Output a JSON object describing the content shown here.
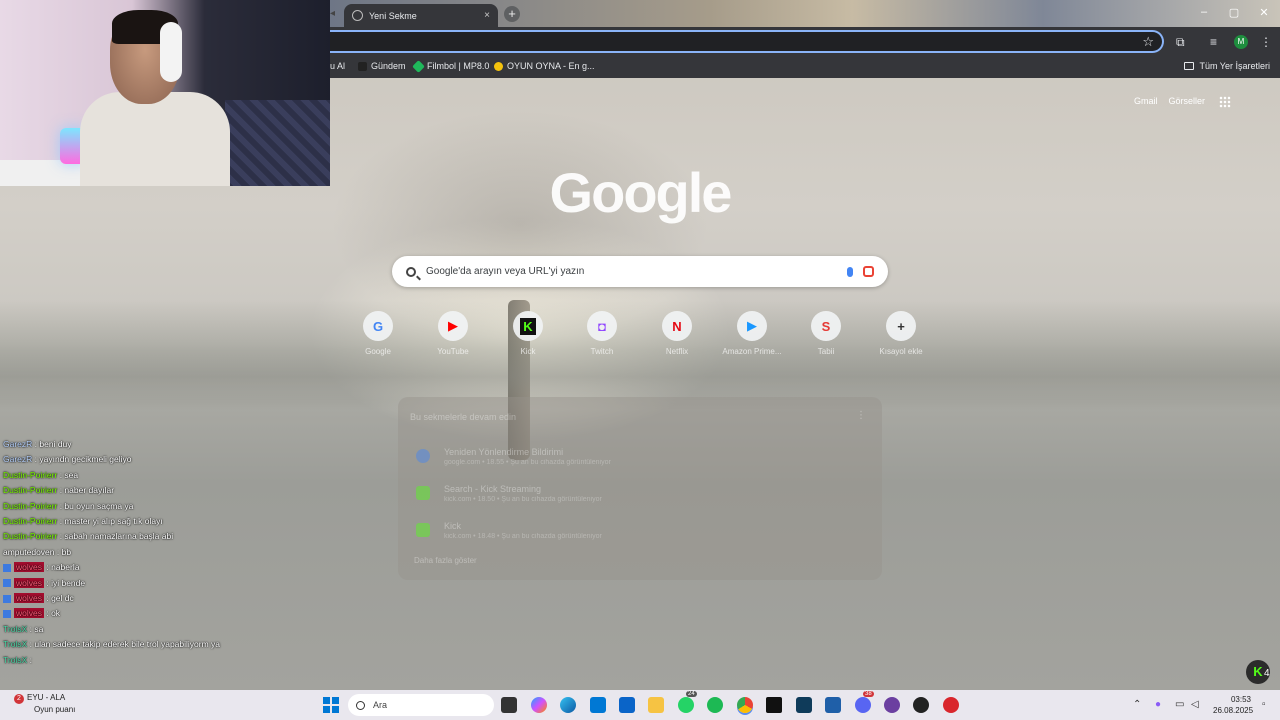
{
  "browser": {
    "tab_title": "Yeni Sekme",
    "tab_close": "×",
    "new_tab": "+",
    "back_glyph": "◂",
    "window_controls": [
      "–",
      "▢",
      "✕"
    ],
    "star": "☆",
    "profile_initial": "M",
    "bookmarks": [
      {
        "label": "u Al",
        "color": "#cfd4da"
      },
      {
        "label": "Gündem",
        "color": "#2a2a2a"
      },
      {
        "label": "Filmbol | MP8.0",
        "color": "#1fb85b"
      },
      {
        "label": "OYUN OYNA - En g...",
        "color": "#f4c20d"
      }
    ],
    "all_bookmarks": "Tüm Yer İşaretleri"
  },
  "ntp": {
    "links": [
      "Gmail",
      "Görseller"
    ],
    "logo": "Google",
    "search_placeholder": "Google'da arayın veya URL'yi yazın",
    "shortcuts": [
      {
        "label": "Google",
        "glyph": "G",
        "color": "#4285f4"
      },
      {
        "label": "YouTube",
        "glyph": "▶",
        "color": "#ff0000"
      },
      {
        "label": "Kick",
        "glyph": "K",
        "color": "#53fc18"
      },
      {
        "label": "Twitch",
        "glyph": "◘",
        "color": "#9146ff"
      },
      {
        "label": "Netflix",
        "glyph": "N",
        "color": "#e50914"
      },
      {
        "label": "Amazon Prime...",
        "glyph": "▶",
        "color": "#1a98ff"
      },
      {
        "label": "Tabii",
        "glyph": "S",
        "color": "#e53935"
      },
      {
        "label": "Kısayol ekle",
        "glyph": "+",
        "color": "#333333"
      }
    ],
    "resume": {
      "title": "Bu sekmelerle devam edin",
      "items": [
        {
          "title": "Yeniden Yönlendirme Bildirimi",
          "subtitle": "google.com • 18.55 • Şu an bu cihazda görüntüleniyor",
          "color": "#4285f4"
        },
        {
          "title": "Search - Kick Streaming",
          "subtitle": "kick.com • 18.50 • Şu an bu cihazda görüntüleniyor",
          "color": "#53fc18"
        },
        {
          "title": "Kick",
          "subtitle": "kick.com • 18.48 • Şu an bu cihazda görüntüleniyor",
          "color": "#53fc18"
        }
      ],
      "more": "Daha fazla göster"
    }
  },
  "chat": [
    {
      "user": "GarezR",
      "msg": "beni duy",
      "color": "#b9d4ff",
      "badge": false
    },
    {
      "user": "GarezR",
      "msg": "yayındn gecikmeli geliyo",
      "color": "#b9d4ff",
      "badge": false
    },
    {
      "user": "Dustin-Poirierr",
      "msg": "sea",
      "color": "#7cfc00",
      "badge": false
    },
    {
      "user": "Dustin-Poirierr",
      "msg": "naber dayılar",
      "color": "#7cfc00",
      "badge": false
    },
    {
      "user": "Dustin-Poirierr",
      "msg": "bu oyun saçma ya",
      "color": "#7cfc00",
      "badge": false
    },
    {
      "user": "Dustin-Poirierr",
      "msg": "master yi alıp sağ tık olayı",
      "color": "#7cfc00",
      "badge": false
    },
    {
      "user": "Dustin-Poirierr",
      "msg": "sabah namazlarına başla abi",
      "color": "#7cfc00",
      "badge": false
    },
    {
      "user": "amputedoven",
      "msg": "bb",
      "color": "#ffffff",
      "badge": false
    },
    {
      "user": "wolves",
      "msg": "naberla",
      "color": "#ff5a78",
      "badge": true
    },
    {
      "user": "wolves",
      "msg": "iyi bende",
      "color": "#ff5a78",
      "badge": true
    },
    {
      "user": "wolves",
      "msg": "gel dc",
      "color": "#ff5a78",
      "badge": true
    },
    {
      "user": "wolves",
      "msg": "ok",
      "color": "#ff5a78",
      "badge": true
    },
    {
      "user": "TrolsX",
      "msg": "sa",
      "color": "#4dd9a8",
      "badge": false
    },
    {
      "user": "TrolsX",
      "msg": "ulan sadece takip ederek bile trol yapabiliyorm ya",
      "color": "#4dd9a8",
      "badge": false
    },
    {
      "user": "TrolsX",
      "msg": "",
      "color": "#4dd9a8",
      "badge": false
    }
  ],
  "kick_float": {
    "glyph": "K",
    "count": "4"
  },
  "taskbar": {
    "weather_badge": "2",
    "weather_line1": "EYU - ALA",
    "weather_line2": "Oyun puanı",
    "search_placeholder": "Ara",
    "time": "03:53",
    "date": "26.08.2025",
    "whatsapp_badge": "24",
    "discord_badge": "38"
  }
}
